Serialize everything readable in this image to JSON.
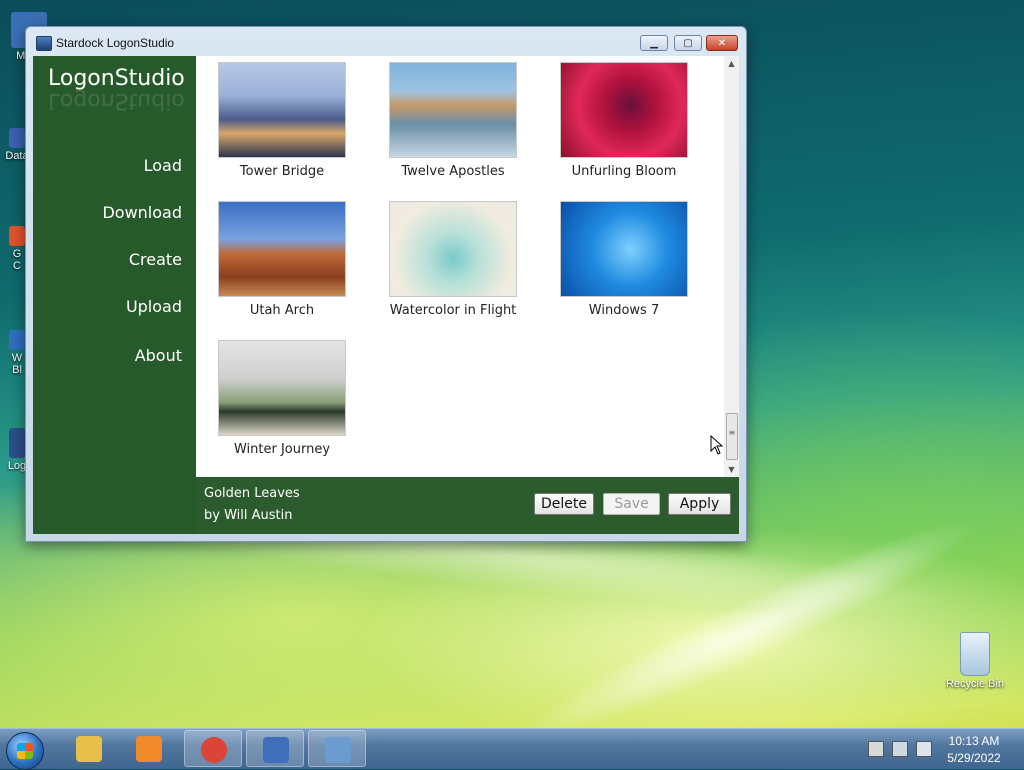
{
  "desktop": {
    "icons": [
      {
        "label": "My C",
        "glyph_color": "#3b6fb5"
      },
      {
        "label": "Data",
        "glyph_color": "#3a62b0"
      },
      {
        "label": "G\nC",
        "glyph_color": "#e0532c"
      },
      {
        "label": "W\nBl",
        "glyph_color": "#2f6fbd"
      },
      {
        "label": "Log",
        "glyph_color": "#2c4f8a"
      },
      {
        "label": "Recycle Bin",
        "glyph_color": "#b9d4ea"
      }
    ]
  },
  "window": {
    "title": "Stardock LogonStudio",
    "controls": {
      "minimize": "▁",
      "maximize": "▢",
      "close": "✕"
    }
  },
  "sidebar": {
    "brand": "LogonStudio",
    "items": [
      {
        "label": "Load"
      },
      {
        "label": "Download"
      },
      {
        "label": "Create"
      },
      {
        "label": "Upload"
      },
      {
        "label": "About"
      }
    ]
  },
  "gallery": {
    "items": [
      {
        "label": "Tower Bridge",
        "thumb": "linear-gradient(#b7c7e6 0%, #9ab0d8 35%, #4a5c8a 60%, #d8a66a 75%, #2a3550 100%)"
      },
      {
        "label": "Twelve Apostles",
        "thumb": "linear-gradient(#7fb3de 0%, #9ec3e0 30%, #c59a6a 45%, #6a8fa8 65%, #c7d7e2 100%)"
      },
      {
        "label": "Unfurling Bloom",
        "thumb": "radial-gradient(circle at 55% 45%, #6a0f3c 0%, #b0123d 30%, #e0285a 60%, #8a0f2d 100%)"
      },
      {
        "label": "Utah Arch",
        "thumb": "linear-gradient(#3b6fc5 0%, #7aa2de 40%, #c06a38 55%, #8a3f1f 80%, #c98a54 100%)"
      },
      {
        "label": "Watercolor in Flight",
        "thumb": "radial-gradient(circle at 50% 60%, #7ac9c9 0%, #b7e0d8 30%, #f1ecdf 70%, #eeeae0 100%)"
      },
      {
        "label": "Windows 7",
        "thumb": "radial-gradient(circle at 55% 50%, #7fd0ff 0%, #1f8be0 45%, #0a4fa8 100%)"
      },
      {
        "label": "Winter Journey",
        "thumb": "linear-gradient(#e4e4e4 0%, #cfcfcf 40%, #8aa07a 65%, #2a3a2a 75%, #dcd6c8 100%)"
      }
    ]
  },
  "scrollbar": {
    "up": "▲",
    "down": "▼",
    "grip": "≡"
  },
  "footer": {
    "theme_title": "Golden Leaves",
    "theme_author": "by Will Austin",
    "buttons": {
      "delete": "Delete",
      "save": "Save",
      "apply": "Apply"
    }
  },
  "taskbar": {
    "items": [
      {
        "name": "explorer",
        "color": "#e7c04b"
      },
      {
        "name": "media-player",
        "color": "#f08a2a"
      },
      {
        "name": "chrome",
        "color": "#db4437"
      },
      {
        "name": "logonstudio",
        "color": "#3f6fb8"
      },
      {
        "name": "image-viewer",
        "color": "#6a9cd0"
      }
    ],
    "clock": {
      "time": "10:13 AM",
      "date": "5/29/2022"
    }
  }
}
